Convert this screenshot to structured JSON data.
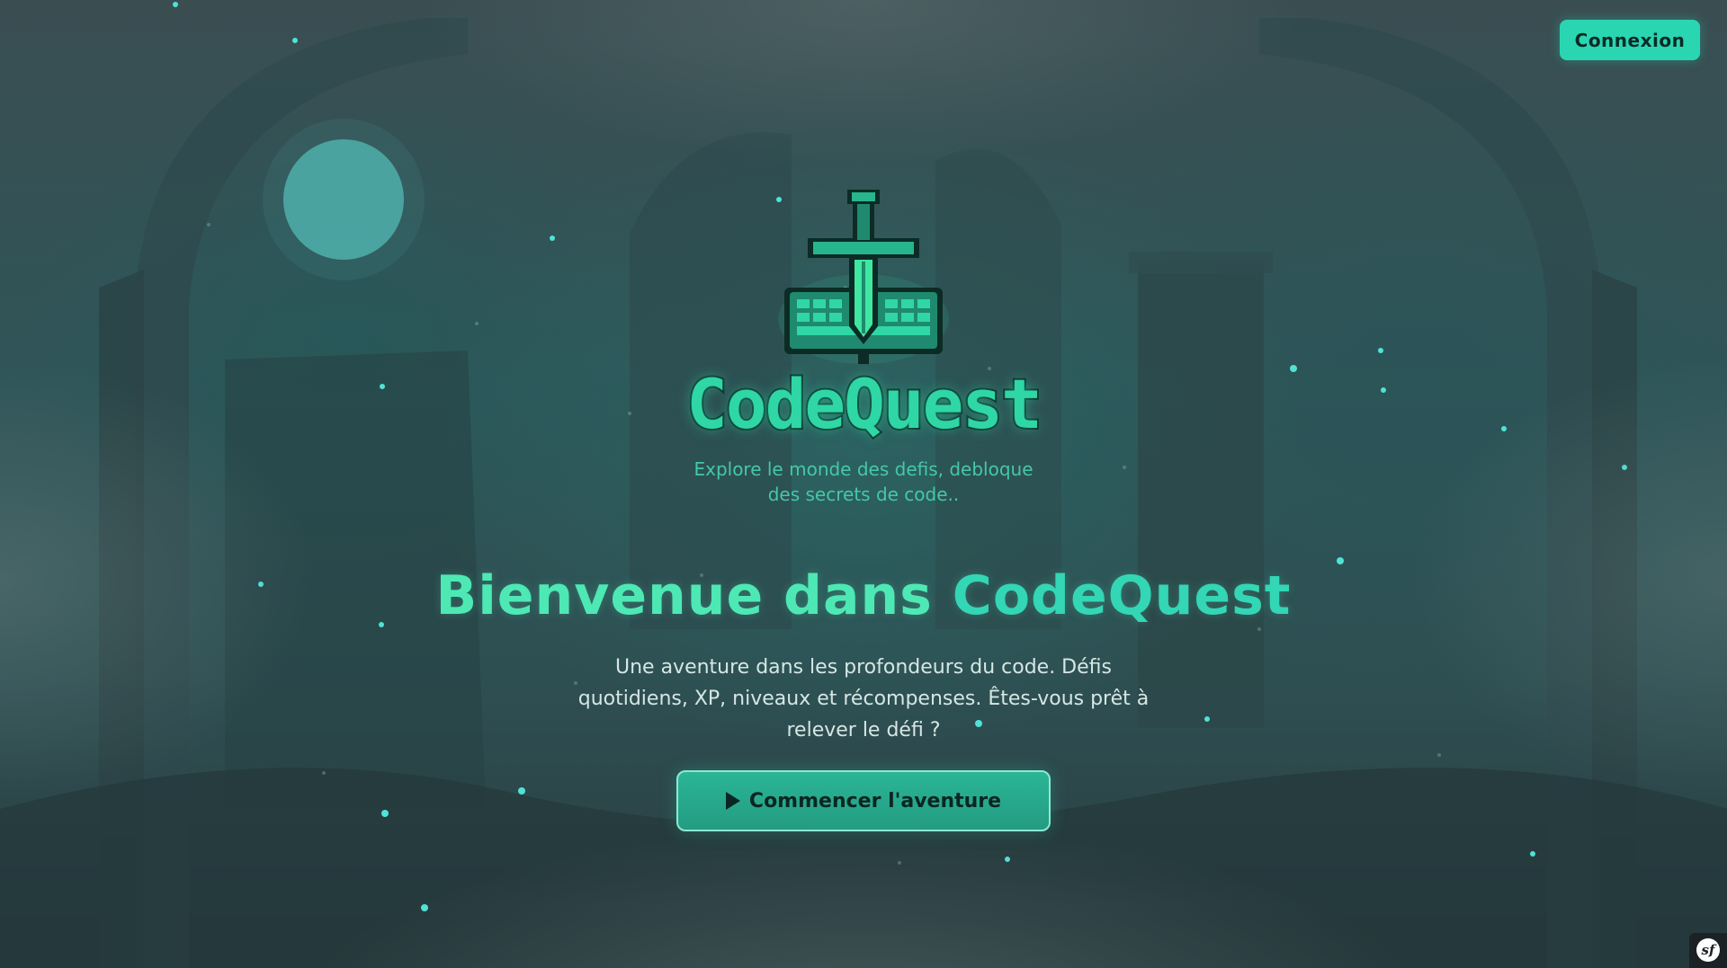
{
  "header": {
    "login_label": "Connexion"
  },
  "logo": {
    "title": "CodeQuest",
    "tagline_line1": "Explore le monde des defis, debloque",
    "tagline_line2": "des secrets de code.."
  },
  "hero": {
    "title_prefix": "Bienvenue dans",
    "title_accent": "CodeQuest",
    "intro_line1": "Une aventure dans les profondeurs du code. Défis",
    "intro_line2": "quotidiens, XP, niveaux et récompenses. Êtes-vous prêt à",
    "intro_line3": "relever le défi ?",
    "start_label": "Commencer l'aventure"
  },
  "debug_toolbar": {
    "icon": "symfony-icon",
    "label": "sf"
  },
  "colors": {
    "accent": "#2ad6b2",
    "title_green": "#4ee8b4",
    "button_teal": "#2bb596"
  }
}
